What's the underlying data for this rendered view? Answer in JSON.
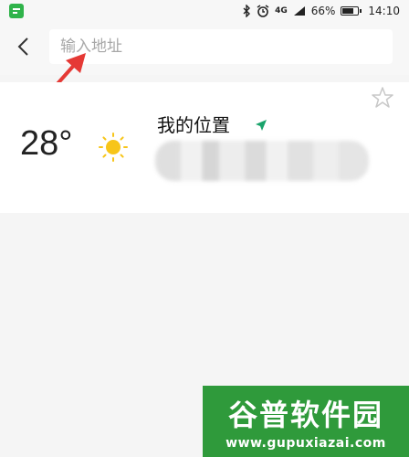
{
  "status_bar": {
    "battery": "66%",
    "time": "14:10",
    "network": "4G"
  },
  "header": {
    "search_placeholder": "输入地址"
  },
  "weather_card": {
    "temperature": "28°",
    "location_title": "我的位置",
    "weather_icon": "sun-icon",
    "location_icon": "navigation-arrow-icon",
    "favorite_icon": "star-outline-icon"
  },
  "watermark": {
    "main": "谷普软件园",
    "sub": "www.gupuxiazai.com"
  },
  "colors": {
    "annotation_red": "#e53935",
    "location_arrow": "#1aa36b",
    "sun": "#f7c519",
    "watermark_bg": "#2f9a3b"
  }
}
